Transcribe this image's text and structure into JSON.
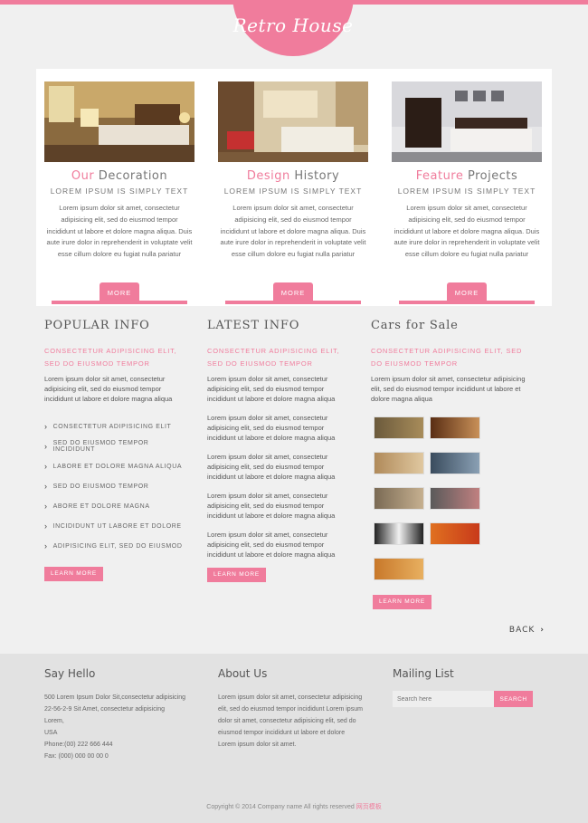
{
  "brand": {
    "logo_text": "Retro House"
  },
  "features": [
    {
      "title_hl": "Our",
      "title_rest": " Decoration",
      "subtitle": "Lorem ipsum is simply text",
      "body": "Lorem ipsum dolor sit amet, consectetur adipisicing elit, sed do eiusmod tempor incididunt ut labore et dolore magna aliqua. Duis aute irure dolor in reprehenderit in voluptate velit esse cillum dolore eu fugiat nulla pariatur",
      "button": "MORE"
    },
    {
      "title_hl": "Design",
      "title_rest": " History",
      "subtitle": "Lorem ipsum is simply text",
      "body": "Lorem ipsum dolor sit amet, consectetur adipisicing elit, sed do eiusmod tempor incididunt ut labore et dolore magna aliqua. Duis aute irure dolor in reprehenderit in voluptate velit esse cillum dolore eu fugiat nulla pariatur",
      "button": "MORE"
    },
    {
      "title_hl": "Feature",
      "title_rest": " Projects",
      "subtitle": "Lorem ipsum is simply text",
      "body": "Lorem ipsum dolor sit amet, consectetur adipisicing elit, sed do eiusmod tempor incididunt ut labore et dolore magna aliqua. Duis aute irure dolor in reprehenderit in voluptate velit esse cillum dolore eu fugiat nulla pariatur",
      "button": "MORE"
    }
  ],
  "popular": {
    "title": "POPULAR INFO",
    "lead": "Consectetur adipisicing elit, sed do eiusmod tempor",
    "body": "Lorem ipsum dolor sit amet, consectetur adipisicing elit, sed do eiusmod tempor incididunt ut labore et dolore magna aliqua",
    "links": [
      "Consectetur adipisicing elit",
      "Sed do eiusmod tempor incididunt",
      "Labore et dolore magna aliqua",
      "Sed do eiusmod tempor",
      "Abore et dolore magna",
      "Incididunt ut labore et dolore",
      "Adipisicing elit, sed do eiusmod"
    ],
    "button": "Learn more"
  },
  "latest": {
    "title": "LATEST INFO",
    "lead": "Consectetur adipisicing elit, sed do eiusmod tempor",
    "paras": [
      "Lorem ipsum dolor sit amet, consectetur adipisicing elit, sed do eiusmod tempor incididunt ut labore et dolore magna aliqua",
      "Lorem ipsum dolor sit amet, consectetur adipisicing elit, sed do eiusmod tempor incididunt ut labore et dolore magna aliqua",
      "Lorem ipsum dolor sit amet, consectetur adipisicing elit, sed do eiusmod tempor incididunt ut labore et dolore magna aliqua",
      "Lorem ipsum dolor sit amet, consectetur adipisicing elit, sed do eiusmod tempor incididunt ut labore et dolore magna aliqua",
      "Lorem ipsum dolor sit amet, consectetur adipisicing elit, sed do eiusmod tempor incididunt ut labore et dolore magna aliqua"
    ],
    "button": "Learn more"
  },
  "cars": {
    "title": "Cars for Sale",
    "lead": "Consectetur adipisicing elit, sed do eiusmod tempor",
    "body": "Lorem ipsum dolor sit amet, consectetur adipisicing elit, sed do eiusmod tempor incididunt ut labore et dolore magna aliqua",
    "button": "Learn more"
  },
  "back": {
    "label": "BACK"
  },
  "footer": {
    "say_hello": {
      "title": "Say Hello",
      "lines": [
        "500 Lorem Ipsum Dolor Sit,consectetur adipisicing",
        "22-56-2-9 Sit Amet, consectetur adipisicing",
        "Lorem,",
        "USA",
        "Phone:(00) 222 666 444",
        "Fax: (000) 000 00 00 0"
      ]
    },
    "about": {
      "title": "About Us",
      "body": "Lorem ipsum dolor sit amet, consectetur adipisicing elit, sed do eiusmod tempor incididunt Lorem ipsum dolor sit amet, consectetur adipisicing elit, sed do eiusmod tempor incididunt ut labore et dolore Lorem ipsum dolor sit amet."
    },
    "mailing": {
      "title": "Mailing List",
      "placeholder": "Search here",
      "button": "SEARCH"
    },
    "copyright": "Copyright © 2014 Company name All rights reserved",
    "copyright_link": "网页模板"
  },
  "colors": {
    "accent": "#f07c9c",
    "footer_bg": "#e2e2e2"
  }
}
